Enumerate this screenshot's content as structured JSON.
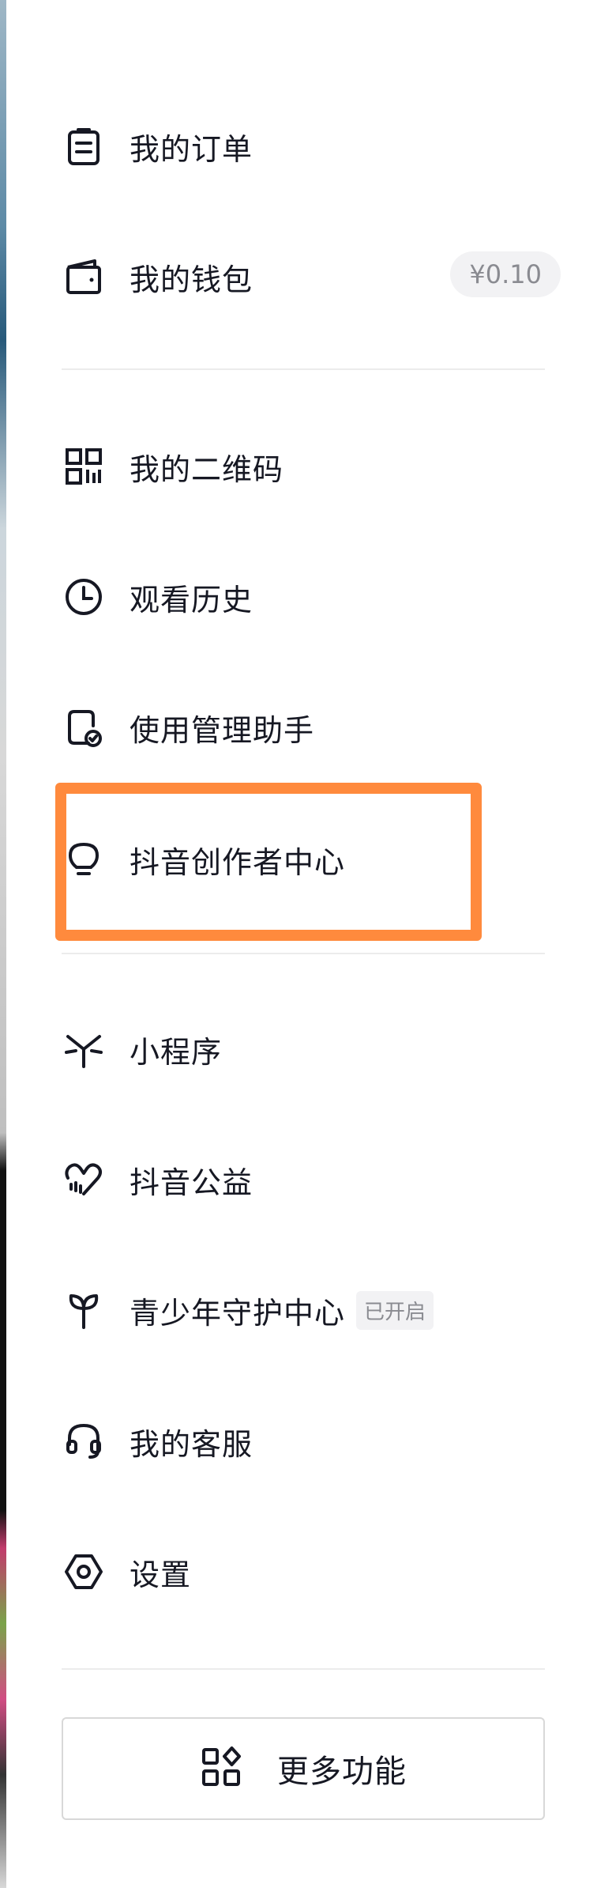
{
  "menu": {
    "orders": {
      "label": "我的订单",
      "icon": "clipboard-icon"
    },
    "wallet": {
      "label": "我的钱包",
      "icon": "wallet-icon",
      "amount": "¥0.10"
    },
    "qrcode": {
      "label": "我的二维码",
      "icon": "qr-code-icon"
    },
    "history": {
      "label": "观看历史",
      "icon": "clock-icon"
    },
    "assistant": {
      "label": "使用管理助手",
      "icon": "phone-check-icon"
    },
    "creator": {
      "label": "抖音创作者中心",
      "icon": "lightbulb-icon"
    },
    "miniprogram": {
      "label": "小程序",
      "icon": "mini-program-icon"
    },
    "charity": {
      "label": "抖音公益",
      "icon": "heart-icon"
    },
    "youth": {
      "label": "青少年守护中心",
      "icon": "sprout-icon",
      "badge": "已开启"
    },
    "service": {
      "label": "我的客服",
      "icon": "headset-icon"
    },
    "settings": {
      "label": "设置",
      "icon": "hexagon-settings-icon"
    }
  },
  "more": {
    "label": "更多功能",
    "icon": "more-functions-icon"
  },
  "colors": {
    "highlight": "#ff8a3d",
    "text": "#161823",
    "muted": "#8a8b91"
  }
}
